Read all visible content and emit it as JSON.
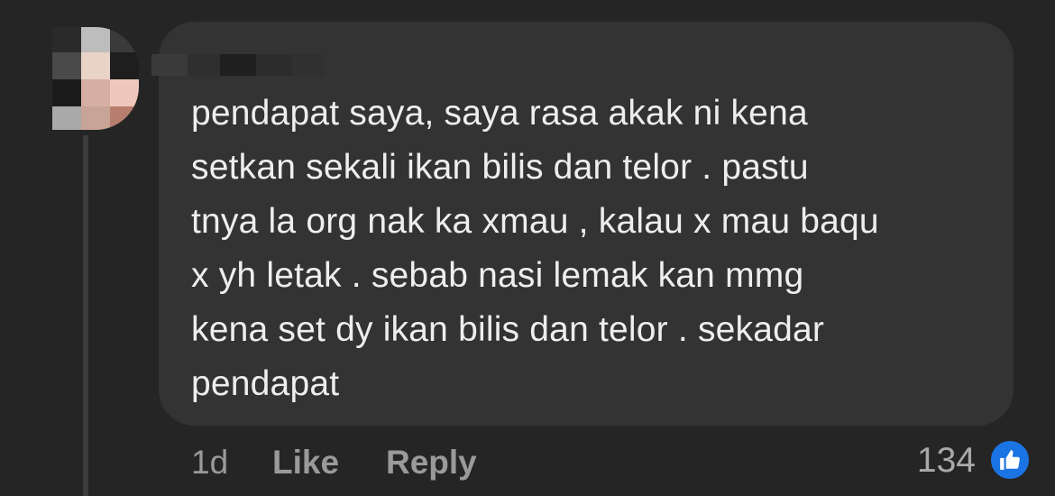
{
  "comment": {
    "author_name": "",
    "lines": [
      "pendapat saya, saya rasa akak ni kena",
      "setkan sekali ikan bilis dan telor . pastu",
      "tnya la org nak ka xmau , kalau x mau baqu",
      "x yh letak . sebab nasi lemak kan mmg",
      "kena set dy ikan bilis dan telor . sekadar",
      "pendapat"
    ]
  },
  "footer": {
    "time": "1d",
    "like_label": "Like",
    "reply_label": "Reply",
    "reaction_count": "134",
    "reaction_icon": "thumbs-up-icon"
  },
  "colors": {
    "background": "#252526",
    "bubble": "#333334",
    "text": "#eeeeee",
    "muted": "#9a9a9c",
    "like_blue": "#1b74e4"
  }
}
